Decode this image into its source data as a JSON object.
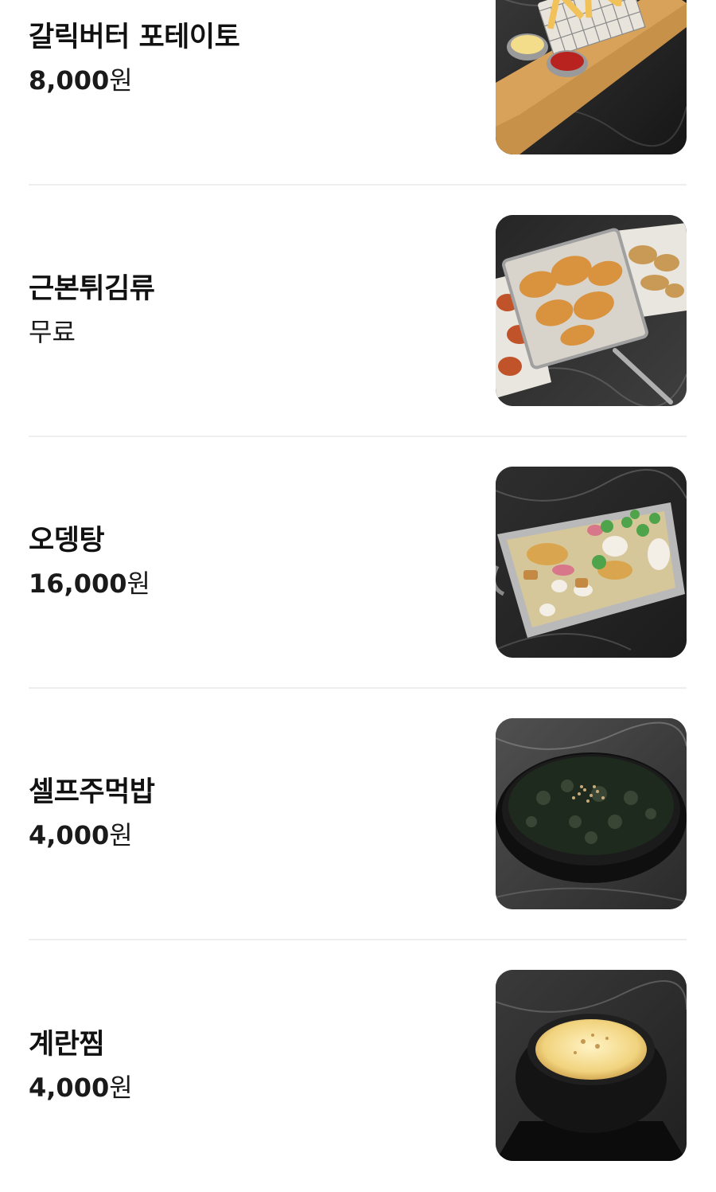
{
  "menu": {
    "items": [
      {
        "name": "갈릭버터 포테이토",
        "price_amount": "8,000",
        "price_unit": "원",
        "photo_icon": "fries-basket-photo"
      },
      {
        "name": "근본튀김류",
        "price_text": "무료",
        "photo_icon": "fried-food-baskets-photo"
      },
      {
        "name": "오뎅탕",
        "price_amount": "16,000",
        "price_unit": "원",
        "photo_icon": "fishcake-soup-pan-photo"
      },
      {
        "name": "셀프주먹밥",
        "price_amount": "4,000",
        "price_unit": "원",
        "photo_icon": "seaweed-rice-bowl-photo"
      },
      {
        "name": "계란찜",
        "price_amount": "4,000",
        "price_unit": "원",
        "photo_icon": "steamed-egg-pot-photo"
      }
    ]
  },
  "colors": {
    "background": "#ffffff",
    "text": "#111111",
    "divider": "#eeeeee",
    "photo_backdrop": "#2a2a2a"
  }
}
